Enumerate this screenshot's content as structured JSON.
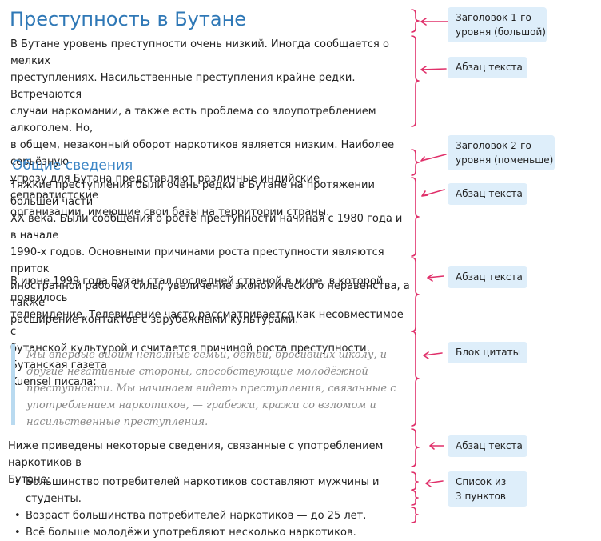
{
  "article": {
    "title": "Преступность в Бутане",
    "intro": [
      "В Бутане уровень преступности очень низкий. Иногда сообщается о мелких",
      "преступлениях. Насильственные преступления крайне редки. Встречаются",
      "случаи наркомании, а также есть проблема со злоупотреблением алкоголем. Но,",
      "в общем, незаконный оборот наркотиков является низким. Наиболее серьёзную",
      "угрозу для Бутана представляют различные индийские сепаратистские",
      "организации, имеющие свои базы на территории страны."
    ],
    "section_title": "Общие сведения",
    "section_para1": [
      "Тяжкие преступления были очень редки в Бутане на протяжении большей части",
      "XX века. Были сообщения о росте преступности начиная с 1980 года и в начале",
      "1990-х годов. Основными причинами роста преступности являются приток",
      "иностранной рабочей силы, увеличение экономического неравенства, а также",
      "расширение контактов с зарубежными культурами."
    ],
    "section_para2": [
      "В июне 1999 года Бутан стал последней страной в мире, в которой появилось",
      "телевидение. Телевидение часто рассматривается как несовместимое с",
      "бутанской культурой и считается причиной роста преступности. Бутанская газета",
      "Kuensel писала:"
    ],
    "quote": [
      "Мы впервые видим неполные семьи, детей, бросивших школу, и",
      "другие негативные стороны, способствующие молодёжной",
      "преступности. Мы начинаем видеть преступления, связанные с",
      "употреблением наркотиков, — грабежи, кражи со взломом и",
      "насильственные преступления."
    ],
    "list_intro": [
      "Ниже приведены некоторые сведения, связанные с употреблением наркотиков в",
      "Бутане:"
    ],
    "list_items": [
      "Большинство потребителей наркотиков составляют мужчины и студенты.",
      "Возраст большинства потребителей наркотиков — до 25 лет.",
      "Всё больше молодёжи употребляют несколько наркотиков."
    ],
    "bullet": "•"
  },
  "annotations": {
    "heading1": [
      "Заголовок 1-го",
      "уровня (большой)"
    ],
    "para1": "Абзац текста",
    "heading2": [
      "Заголовок 2-го",
      "уровня (поменьше)"
    ],
    "para2": "Абзац текста",
    "para3": "Абзац текста",
    "quote": "Блок цитаты",
    "para4": "Абзац текста",
    "list": [
      "Список из",
      "3 пунктов"
    ]
  },
  "colors": {
    "heading": "#2f78b6",
    "annotation_bracket": "#e0306a",
    "annotation_label_bg": "#deeefa",
    "quote_bar": "#b9daf0"
  }
}
